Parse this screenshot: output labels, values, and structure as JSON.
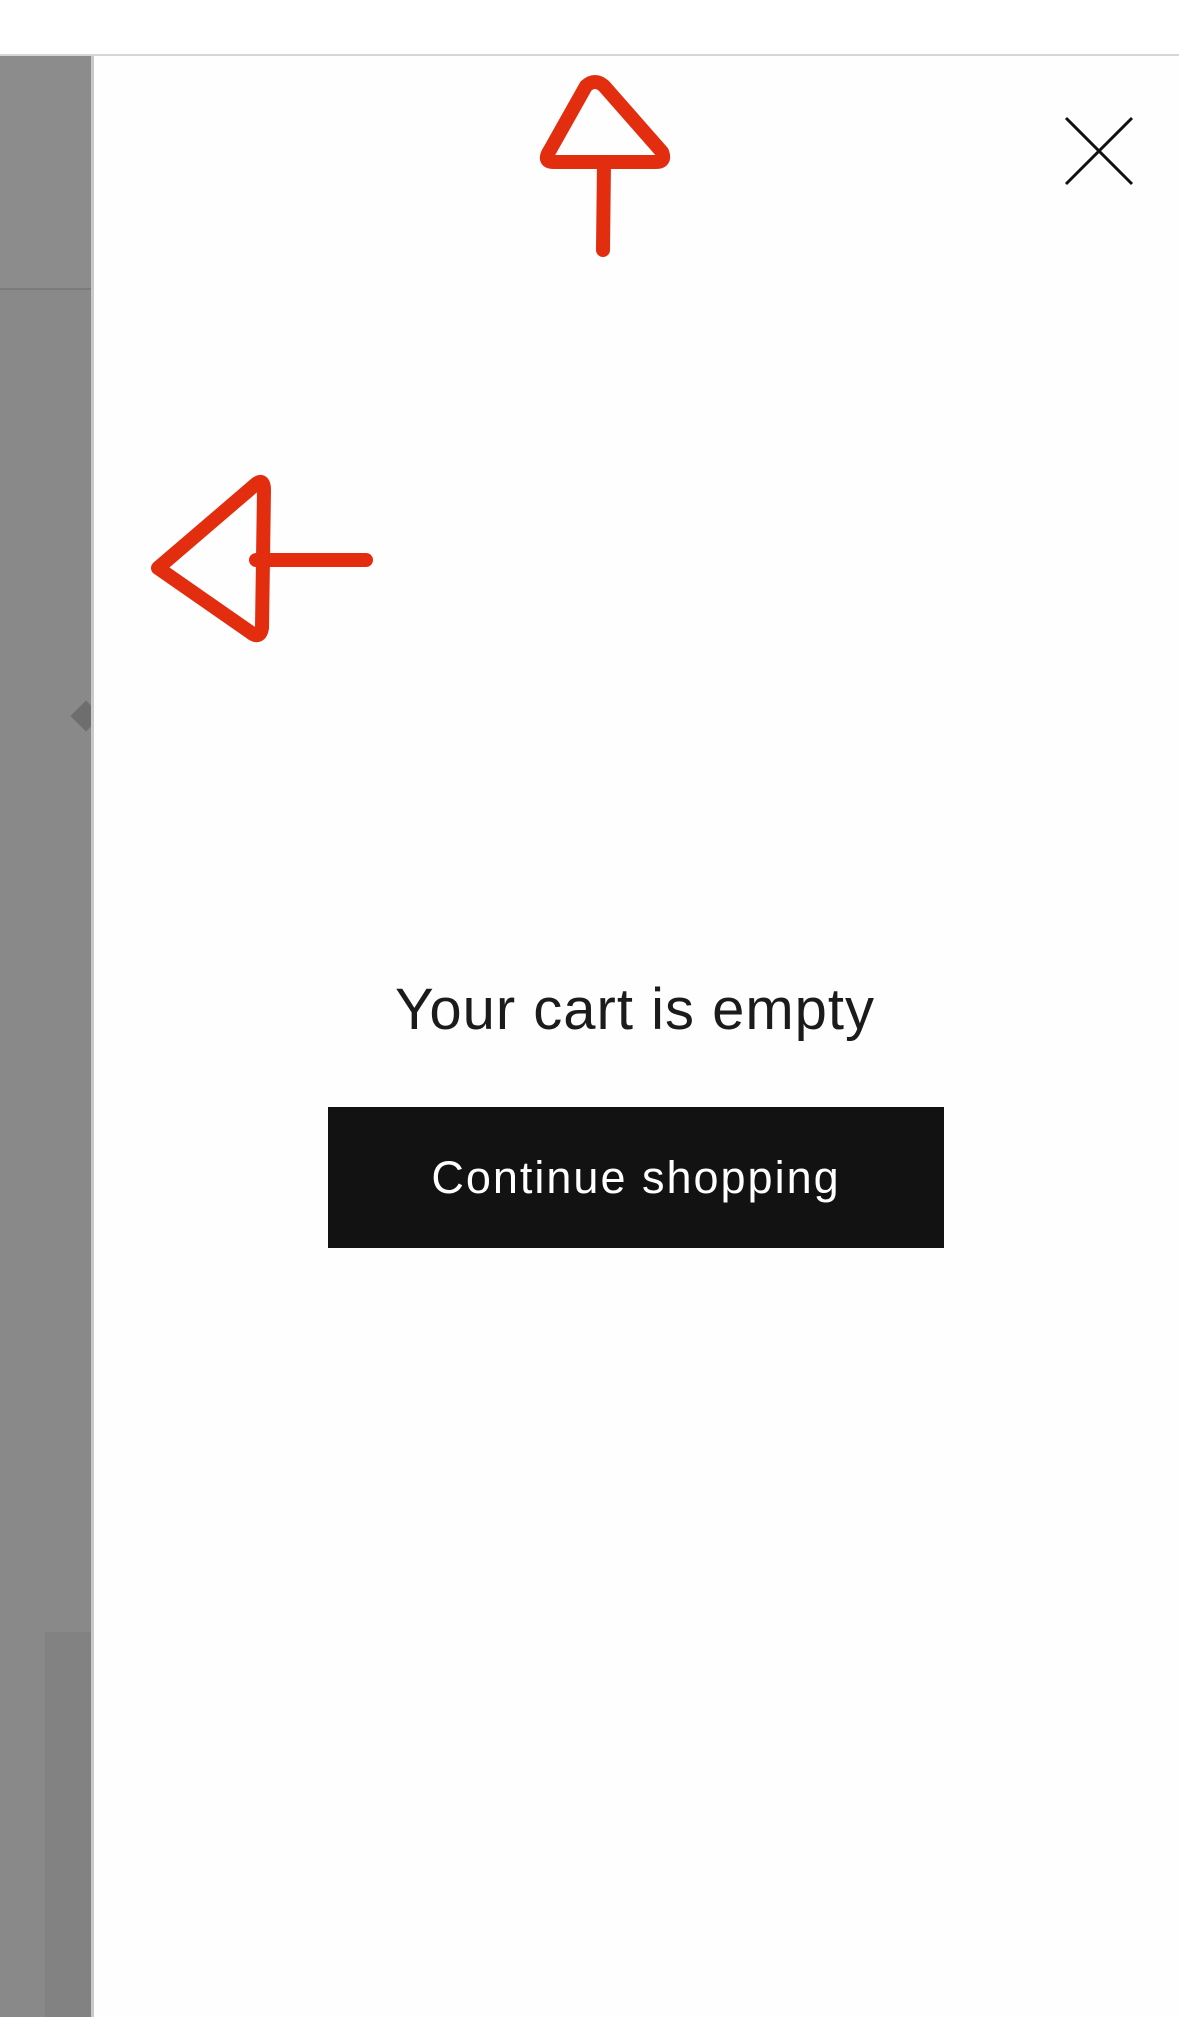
{
  "cart_drawer": {
    "empty_message": "Your cart is empty",
    "continue_label": "Continue shopping",
    "close_icon": "close-icon"
  },
  "annotations": [
    {
      "icon": "red-arrow-up-icon",
      "color": "#e22d0f"
    },
    {
      "icon": "red-arrow-left-icon",
      "color": "#e22d0f"
    }
  ],
  "colors": {
    "overlay": "#898989",
    "button_bg": "#121212",
    "button_text": "#ffffff",
    "annotation": "#e22d0f"
  }
}
